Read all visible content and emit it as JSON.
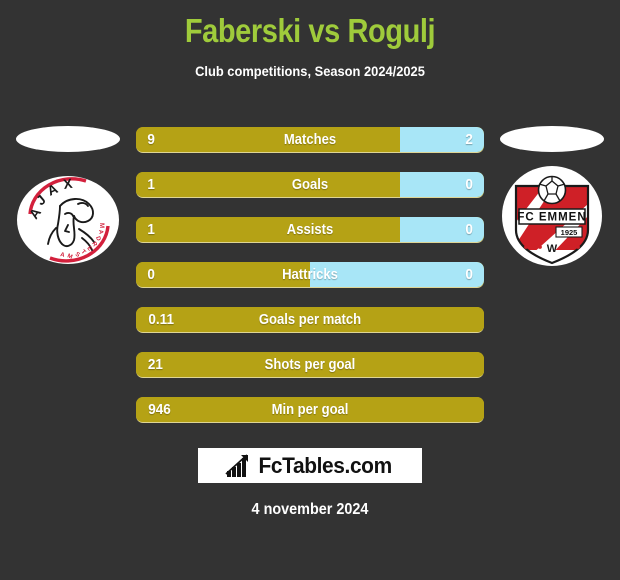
{
  "header": {
    "title": "Faberski vs Rogulj",
    "subtitle": "Club competitions, Season 2024/2025",
    "title_color": "#9fcb3b"
  },
  "teams": {
    "home": {
      "name": "AJAX",
      "badge_name": "ajax-amsterdam-crest",
      "sub_text": "AMSTERDAM",
      "color": "#d3203c"
    },
    "away": {
      "name": "FC EMMEN",
      "badge_name": "fc-emmen-crest",
      "founded": "1925",
      "color": "#d3203c"
    }
  },
  "colors": {
    "background": "#333333",
    "home_bar": "#b5a215",
    "away_bar": "#a8e6f7",
    "text": "#ffffff"
  },
  "chart_data": {
    "type": "bar",
    "title": "Faberski vs Rogulj",
    "subtitle": "Club competitions, Season 2024/2025",
    "categories": [
      "Matches",
      "Goals",
      "Assists",
      "Hattricks",
      "Goals per match",
      "Shots per goal",
      "Min per goal"
    ],
    "series": [
      {
        "name": "Faberski",
        "values": [
          "9",
          "1",
          "1",
          "0",
          "0.11",
          "21",
          "946"
        ]
      },
      {
        "name": "Rogulj",
        "values": [
          "2",
          "0",
          "0",
          "0",
          null,
          null,
          null
        ]
      }
    ],
    "legend": "none",
    "grid": false
  },
  "stats": [
    {
      "label": "Matches",
      "home": "9",
      "away": "2",
      "home_pct": 76,
      "split": true
    },
    {
      "label": "Goals",
      "home": "1",
      "away": "0",
      "home_pct": 76,
      "split": true
    },
    {
      "label": "Assists",
      "home": "1",
      "away": "0",
      "home_pct": 76,
      "split": true
    },
    {
      "label": "Hattricks",
      "home": "0",
      "away": "0",
      "home_pct": 50,
      "split": true
    },
    {
      "label": "Goals per match",
      "home": "0.11",
      "away": "",
      "home_pct": 100,
      "split": false
    },
    {
      "label": "Shots per goal",
      "home": "21",
      "away": "",
      "home_pct": 100,
      "split": false
    },
    {
      "label": "Min per goal",
      "home": "946",
      "away": "",
      "home_pct": 100,
      "split": false
    }
  ],
  "footer": {
    "logo_text": "FcTables.com",
    "logo_icon": "bar-chart-arrow-icon",
    "date": "4 november 2024"
  }
}
